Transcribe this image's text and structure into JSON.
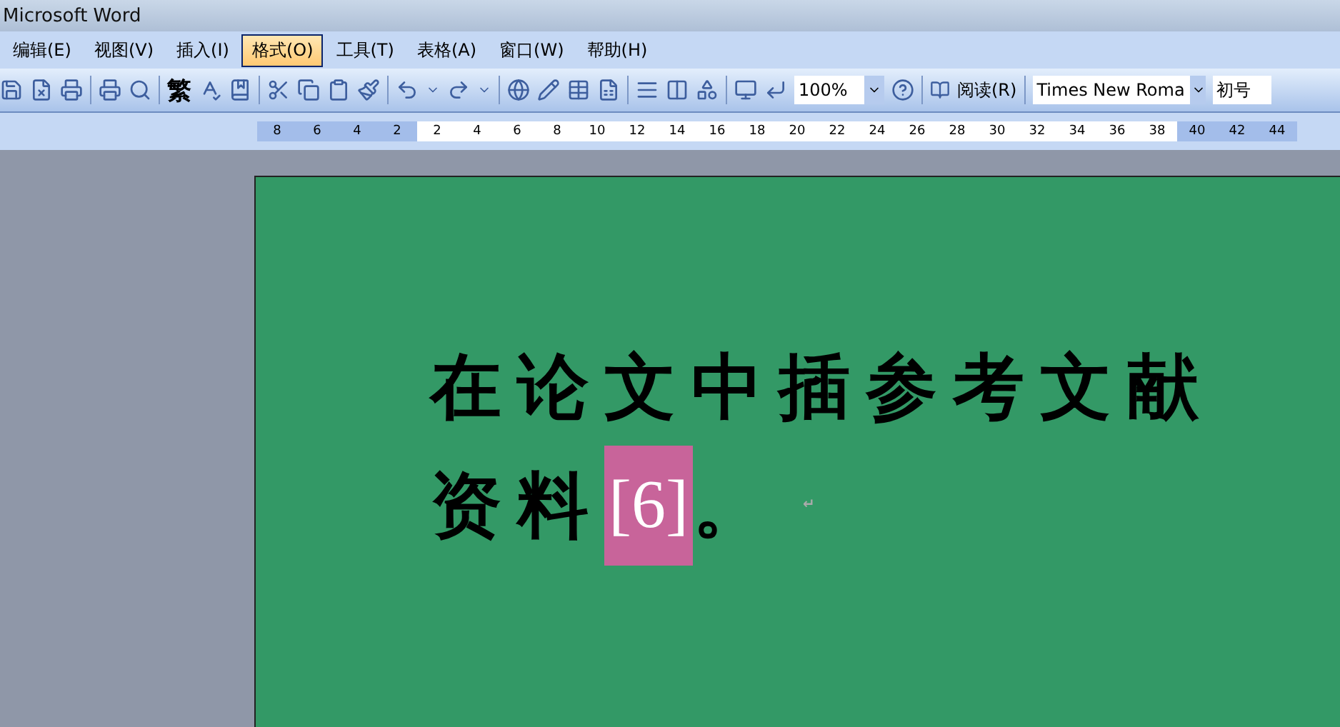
{
  "window": {
    "title": "Microsoft Word"
  },
  "menu": [
    {
      "label": "编辑(E)",
      "selected": false
    },
    {
      "label": "视图(V)",
      "selected": false
    },
    {
      "label": "插入(I)",
      "selected": false
    },
    {
      "label": "格式(O)",
      "selected": true
    },
    {
      "label": "工具(T)",
      "selected": false
    },
    {
      "label": "表格(A)",
      "selected": false
    },
    {
      "label": "窗口(W)",
      "selected": false
    },
    {
      "label": "帮助(H)",
      "selected": false
    }
  ],
  "toolbar": {
    "traditional_label": "繁",
    "zoom": "100%",
    "read_button": "阅读(R)",
    "font": "Times New Roma",
    "font_size": "初号"
  },
  "ruler": {
    "left_labels": [
      "8",
      "6",
      "4",
      "2"
    ],
    "right_labels": [
      "2",
      "4",
      "6",
      "8",
      "10",
      "12",
      "14",
      "16",
      "18",
      "20",
      "22",
      "24",
      "26",
      "28",
      "30",
      "32",
      "34",
      "36",
      "38",
      "40",
      "42",
      "44"
    ]
  },
  "document": {
    "line_1": "在论文中插参考文献",
    "line_2_text": "资料",
    "citation": "[6]",
    "line_2_end": "。",
    "paragraph_mark": "↵"
  }
}
